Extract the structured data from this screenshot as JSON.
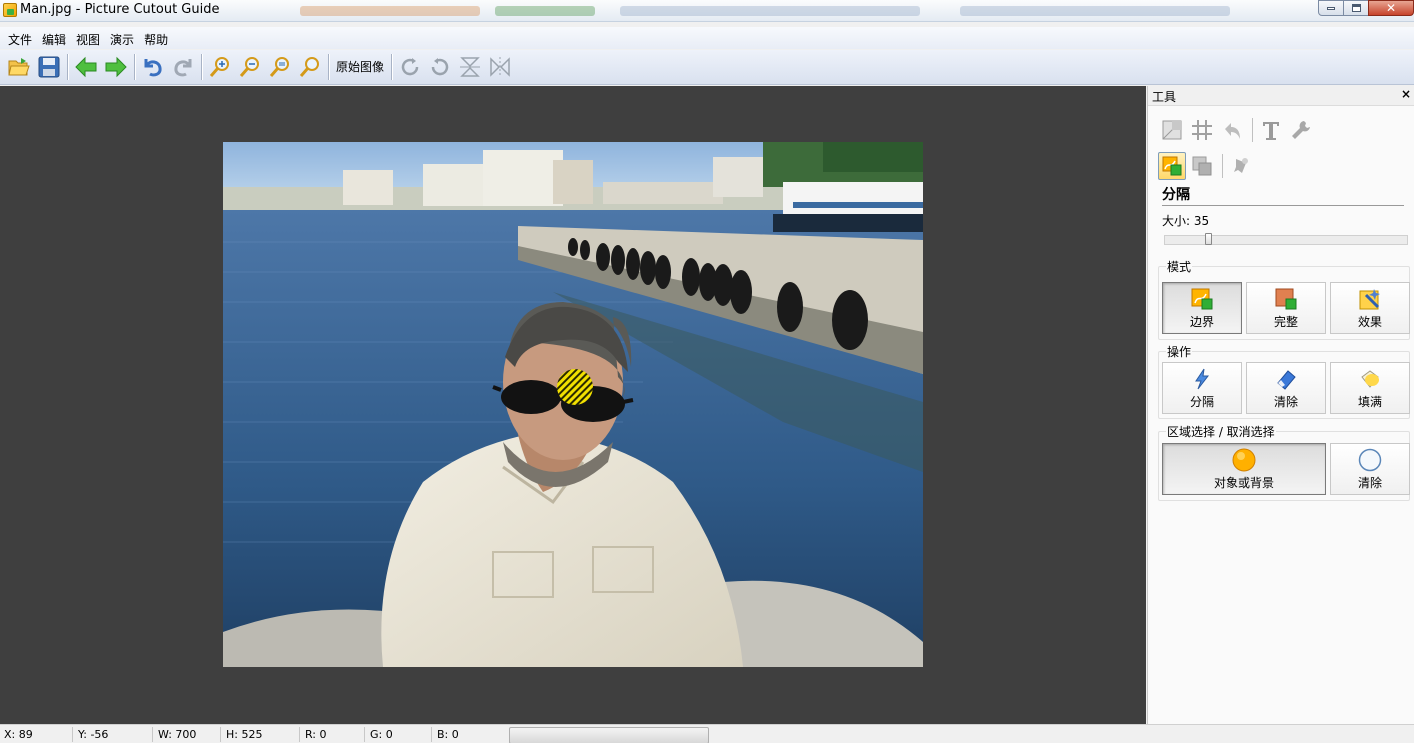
{
  "window": {
    "title": "Man.jpg - Picture Cutout Guide",
    "close_glyph": "✕"
  },
  "menu": [
    "文件",
    "编辑",
    "视图",
    "演示",
    "帮助"
  ],
  "toolbar": {
    "original_image_label": "原始图像",
    "icons": [
      "open-folder-icon",
      "save-icon",
      "back-arrow-icon",
      "forward-arrow-icon",
      "undo-icon",
      "redo-icon",
      "zoom-in-icon",
      "zoom-out-icon",
      "zoom-fit-icon",
      "zoom-actual-icon",
      "rotate-right-icon",
      "rotate-left-icon",
      "flip-vertical-icon",
      "flip-horizontal-icon"
    ]
  },
  "panel": {
    "title": "工具",
    "close_glyph": "×",
    "section_title": "分隔",
    "size_label": "大小: 35",
    "size_value": 35,
    "mode_group": {
      "label": "模式",
      "buttons": [
        {
          "label": "边界",
          "pressed": true
        },
        {
          "label": "完整",
          "pressed": false
        },
        {
          "label": "效果",
          "pressed": false
        }
      ]
    },
    "operation_group": {
      "label": "操作",
      "buttons": [
        {
          "label": "分隔"
        },
        {
          "label": "清除"
        },
        {
          "label": "填满"
        }
      ]
    },
    "region_group": {
      "label": "区域选择 / 取消选择",
      "buttons": [
        {
          "label": "对象或背景",
          "pressed": true
        },
        {
          "label": "清除",
          "pressed": false
        }
      ]
    }
  },
  "status": {
    "x": "X: 89",
    "y": "Y: -56",
    "w": "W: 700",
    "h": "H: 525",
    "r": "R: 0",
    "g": "G: 0",
    "b": "B: 0"
  },
  "colors": {
    "workspace_bg": "#3f3f3f",
    "marker_yellow": "#f2e000"
  }
}
